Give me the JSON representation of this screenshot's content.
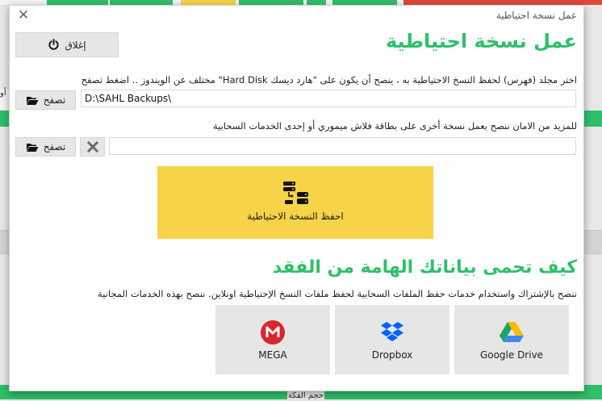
{
  "background": {
    "left_fragment": "أو",
    "bottom_fragment": "حجم الفكة"
  },
  "dialog": {
    "title": "عمل نسخة احتياطية",
    "heading": "عمل نسخة احتياطية",
    "close_button_label": "إغلاق",
    "folder_instruction": "اختر مجلد (فهرس) لحفظ النسخ الاحتياطية به ، ينصح أن يكون على \"هارد ديسك Hard Disk\" مختلف عن الويندوز .. اضغط تصفح",
    "browse_label": "تصفح",
    "backup_path": "D:\\SAHL Backups\\",
    "extra_instruction": "للمزيد من الامان ننصح بعمل نسخة أخرى على بطاقة فلاش ميموري أو إحدى الخدمات السحابية",
    "extra_path": "",
    "backup_button_label": "احفظ النسخة الاحتياطية",
    "section_heading": "كيف تحمى بياناتك الهامة من الفقد",
    "cloud_recommendation": "ننصح بالإشتراك واستخدام خدمات حفظ الملفات السحابية لحفظ ملفات النسخ الإحتياطية اونلاين. ننصح بهذه الخدمات المجانية",
    "services": [
      {
        "name": "MEGA",
        "icon": "mega-icon",
        "color": "#d9272e"
      },
      {
        "name": "Dropbox",
        "icon": "dropbox-icon",
        "color": "#0061fe"
      },
      {
        "name": "Google Drive",
        "icon": "google-drive-icon",
        "color": "#1fa463"
      }
    ]
  },
  "colors": {
    "accent_green": "#2fbf6a",
    "backup_yellow": "#f7d348",
    "button_grey": "#e6e6e6"
  }
}
